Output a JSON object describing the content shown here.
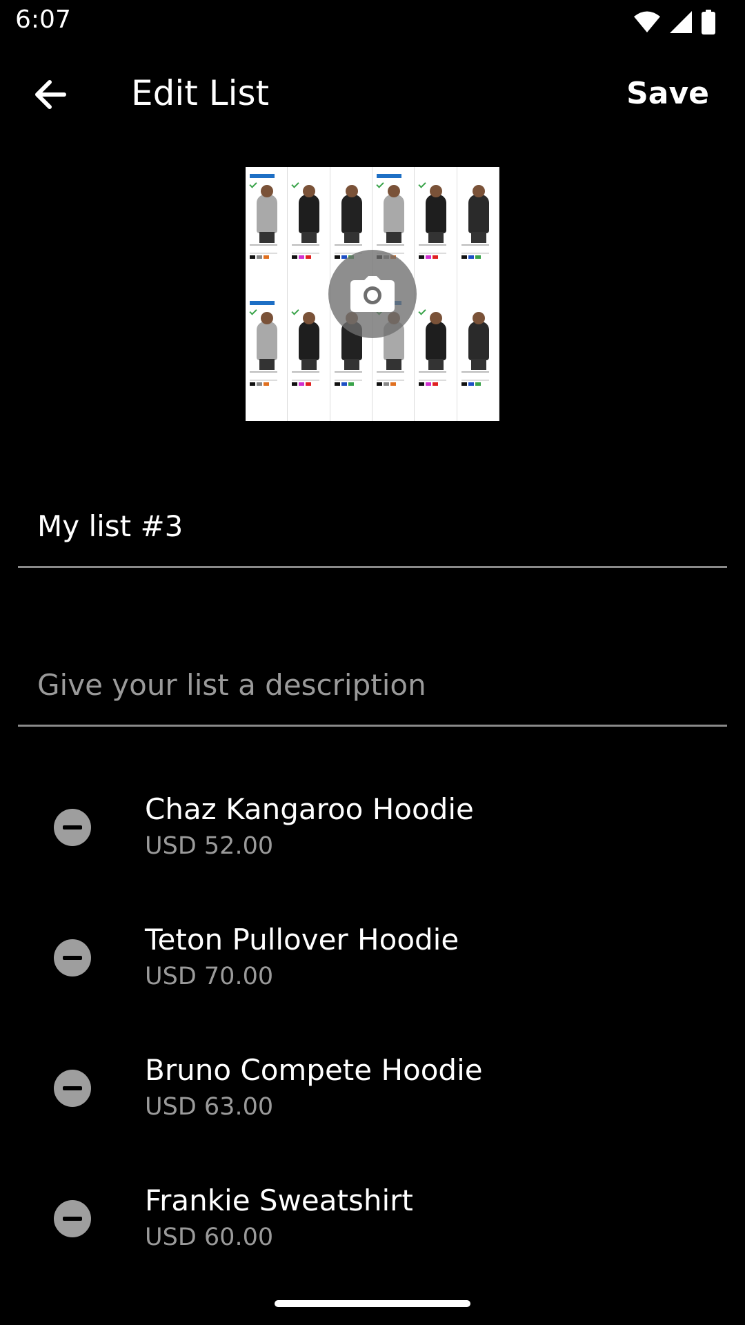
{
  "status_bar": {
    "time": "6:07",
    "icons": [
      "wifi-icon",
      "cell-signal-icon",
      "battery-icon"
    ]
  },
  "app_bar": {
    "title": "Edit List",
    "save_label": "Save",
    "back_icon": "arrow-left-icon"
  },
  "list_image": {
    "overlay_icon": "camera-icon"
  },
  "form": {
    "name_value": "My list #3",
    "description_placeholder": "Give your list a description"
  },
  "items": [
    {
      "name": "Chaz Kangaroo Hoodie",
      "price": "USD 52.00"
    },
    {
      "name": "Teton Pullover Hoodie",
      "price": "USD 70.00"
    },
    {
      "name": "Bruno Compete Hoodie",
      "price": "USD 63.00"
    },
    {
      "name": "Frankie Sweatshirt",
      "price": "USD 60.00"
    }
  ],
  "colors": {
    "background": "#000000",
    "text_primary": "#ffffff",
    "text_secondary": "#9a9a9a",
    "divider": "#8a8a8a",
    "remove_icon": "#9e9e9e"
  }
}
